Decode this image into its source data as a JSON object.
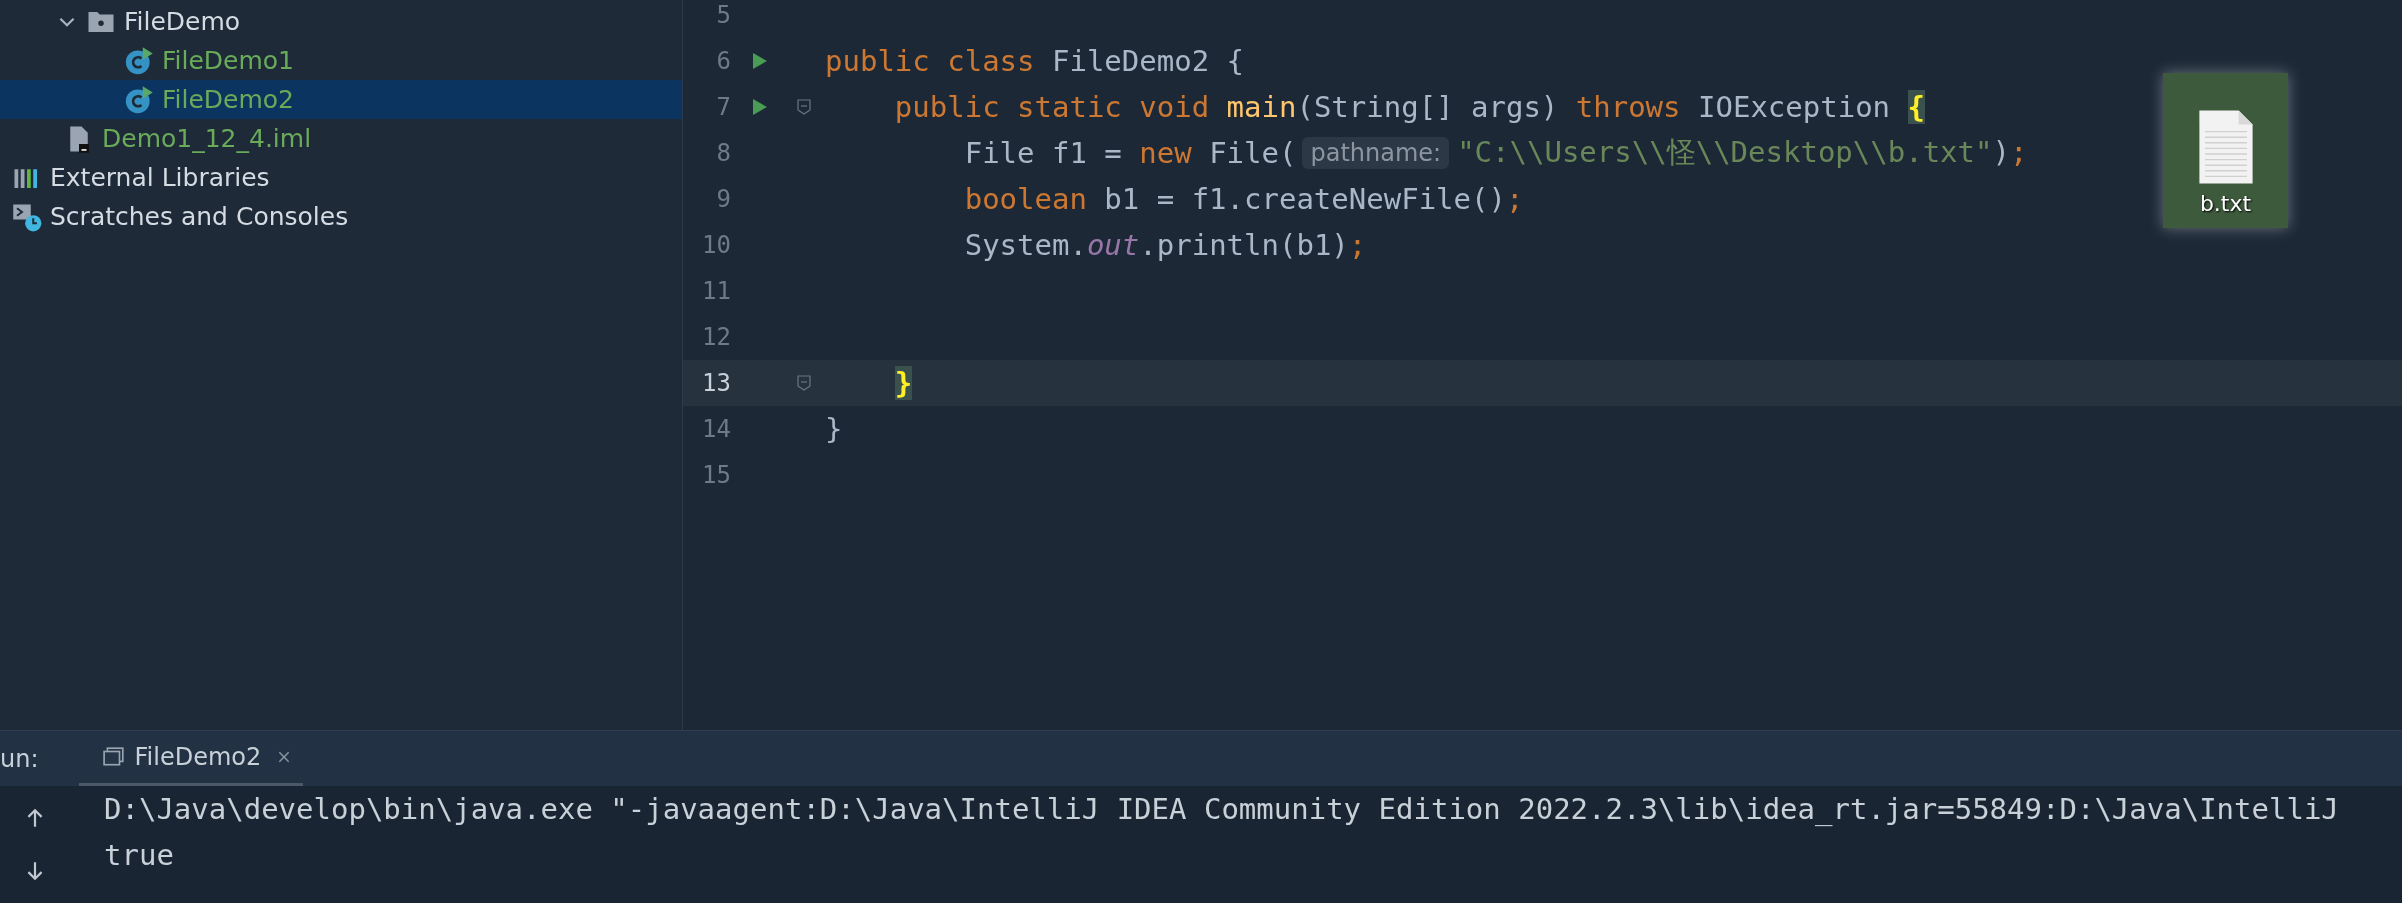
{
  "project_tree": {
    "nested_items": [
      {
        "label": "FileDemo",
        "kind": "folder",
        "expanded": true,
        "added": false,
        "selected": false,
        "children": [
          {
            "label": "FileDemo1",
            "kind": "class",
            "added": true,
            "selected": false
          },
          {
            "label": "FileDemo2",
            "kind": "class",
            "added": true,
            "selected": true
          }
        ]
      },
      {
        "label": "Demo1_12_4.iml",
        "kind": "module-file",
        "added": true,
        "selected": false
      }
    ],
    "items": [
      {
        "label": "External Libraries",
        "kind": "libraries",
        "added": false,
        "selected": false
      },
      {
        "label": "Scratches and Consoles",
        "kind": "scratches",
        "added": false,
        "selected": false
      }
    ]
  },
  "editor": {
    "lines": [
      {
        "number": "5",
        "run": false,
        "fold": false,
        "current": false
      },
      {
        "number": "6",
        "run": true,
        "fold": false,
        "current": false,
        "tokens": [
          {
            "kind": "keyword",
            "text": "public class "
          },
          {
            "kind": "plain",
            "text": "FileDemo2 {"
          }
        ]
      },
      {
        "number": "7",
        "run": true,
        "fold": true,
        "current": false,
        "tokens": [
          {
            "kind": "keyword",
            "text": "    public static void "
          },
          {
            "kind": "method",
            "text": "main"
          },
          {
            "kind": "plain",
            "text": "(String[] args) "
          },
          {
            "kind": "keyword",
            "text": "throws "
          },
          {
            "kind": "plain",
            "text": "IOException "
          },
          {
            "kind": "brace-match",
            "text": "{"
          }
        ]
      },
      {
        "number": "8",
        "run": false,
        "fold": false,
        "current": false,
        "tokens": [
          {
            "kind": "plain",
            "text": "        File f1 = "
          },
          {
            "kind": "keyword",
            "text": "new "
          },
          {
            "kind": "plain",
            "text": "File("
          },
          {
            "kind": "hint",
            "text": "pathname:"
          },
          {
            "kind": "string",
            "text": "\"C:\\\\Users\\\\怪\\\\Desktop\\\\b.txt\""
          },
          {
            "kind": "plain",
            "text": ")"
          },
          {
            "kind": "keyword",
            "text": ";"
          }
        ]
      },
      {
        "number": "9",
        "run": false,
        "fold": false,
        "current": false,
        "tokens": [
          {
            "kind": "keyword",
            "text": "        boolean "
          },
          {
            "kind": "plain",
            "text": "b1 = f1.createNewFile()"
          },
          {
            "kind": "keyword",
            "text": ";"
          }
        ]
      },
      {
        "number": "10",
        "run": false,
        "fold": false,
        "current": false,
        "tokens": [
          {
            "kind": "plain",
            "text": "        System."
          },
          {
            "kind": "field",
            "text": "out"
          },
          {
            "kind": "plain",
            "text": ".println(b1)"
          },
          {
            "kind": "keyword",
            "text": ";"
          }
        ]
      },
      {
        "number": "11",
        "run": false,
        "fold": false,
        "current": false
      },
      {
        "number": "12",
        "run": false,
        "fold": false,
        "current": false
      },
      {
        "number": "13",
        "run": false,
        "fold": true,
        "current": true,
        "tokens": [
          {
            "kind": "brace-match",
            "text": "    }"
          }
        ]
      },
      {
        "number": "14",
        "run": false,
        "fold": false,
        "current": false,
        "tokens": [
          {
            "kind": "plain",
            "text": "}"
          }
        ]
      },
      {
        "number": "15",
        "run": false,
        "fold": false,
        "current": false
      }
    ]
  },
  "desktop_file": {
    "label": "b.txt"
  },
  "run_panel": {
    "label": "un:",
    "tabs": [
      {
        "label": "FileDemo2",
        "selected": true
      }
    ],
    "console_lines": [
      "D:\\Java\\develop\\bin\\java.exe \"-javaagent:D:\\Java\\IntelliJ IDEA Community Edition 2022.2.3\\lib\\idea_rt.jar=55849:D:\\Java\\IntelliJ",
      "true"
    ]
  }
}
